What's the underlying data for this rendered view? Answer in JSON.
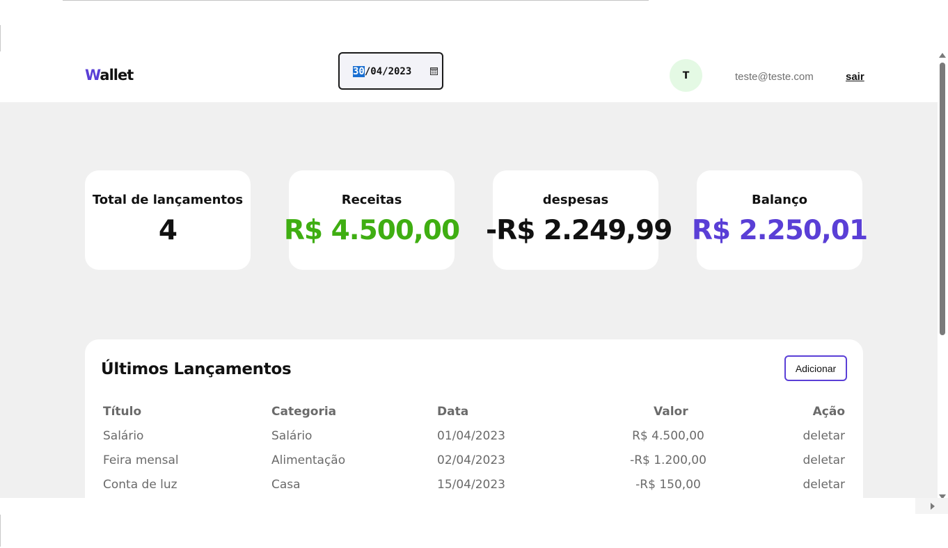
{
  "header": {
    "logo_first": "W",
    "logo_rest": "allet",
    "date_selected": "30",
    "date_rest": "/04/2023",
    "avatar_initial": "T",
    "email": "teste@teste.com",
    "logout_label": "sair"
  },
  "summary": [
    {
      "title": "Total de lançamentos",
      "value": "4",
      "color": "#111111"
    },
    {
      "title": "Receitas",
      "value": "R$ 4.500,00",
      "color": "#3fae12"
    },
    {
      "title": "despesas",
      "value": "-R$ 2.249,99",
      "color": "#111111"
    },
    {
      "title": "Balanço",
      "value": "R$ 2.250,01",
      "color": "#5a3fd6"
    }
  ],
  "transactions": {
    "title": "Últimos Lançamentos",
    "add_label": "Adicionar",
    "columns": [
      "Título",
      "Categoria",
      "Data",
      "Valor",
      "Ação"
    ],
    "rows": [
      {
        "title": "Salário",
        "category": "Salário",
        "date": "01/04/2023",
        "value": "R$ 4.500,00",
        "action": "deletar"
      },
      {
        "title": "Feira mensal",
        "category": "Alimentação",
        "date": "02/04/2023",
        "value": "-R$ 1.200,00",
        "action": "deletar"
      },
      {
        "title": "Conta de luz",
        "category": "Casa",
        "date": "15/04/2023",
        "value": "-R$ 150,00",
        "action": "deletar"
      }
    ]
  },
  "colors": {
    "accent": "#5a3fd6",
    "income": "#3fae12",
    "background": "#f0f0f0"
  }
}
